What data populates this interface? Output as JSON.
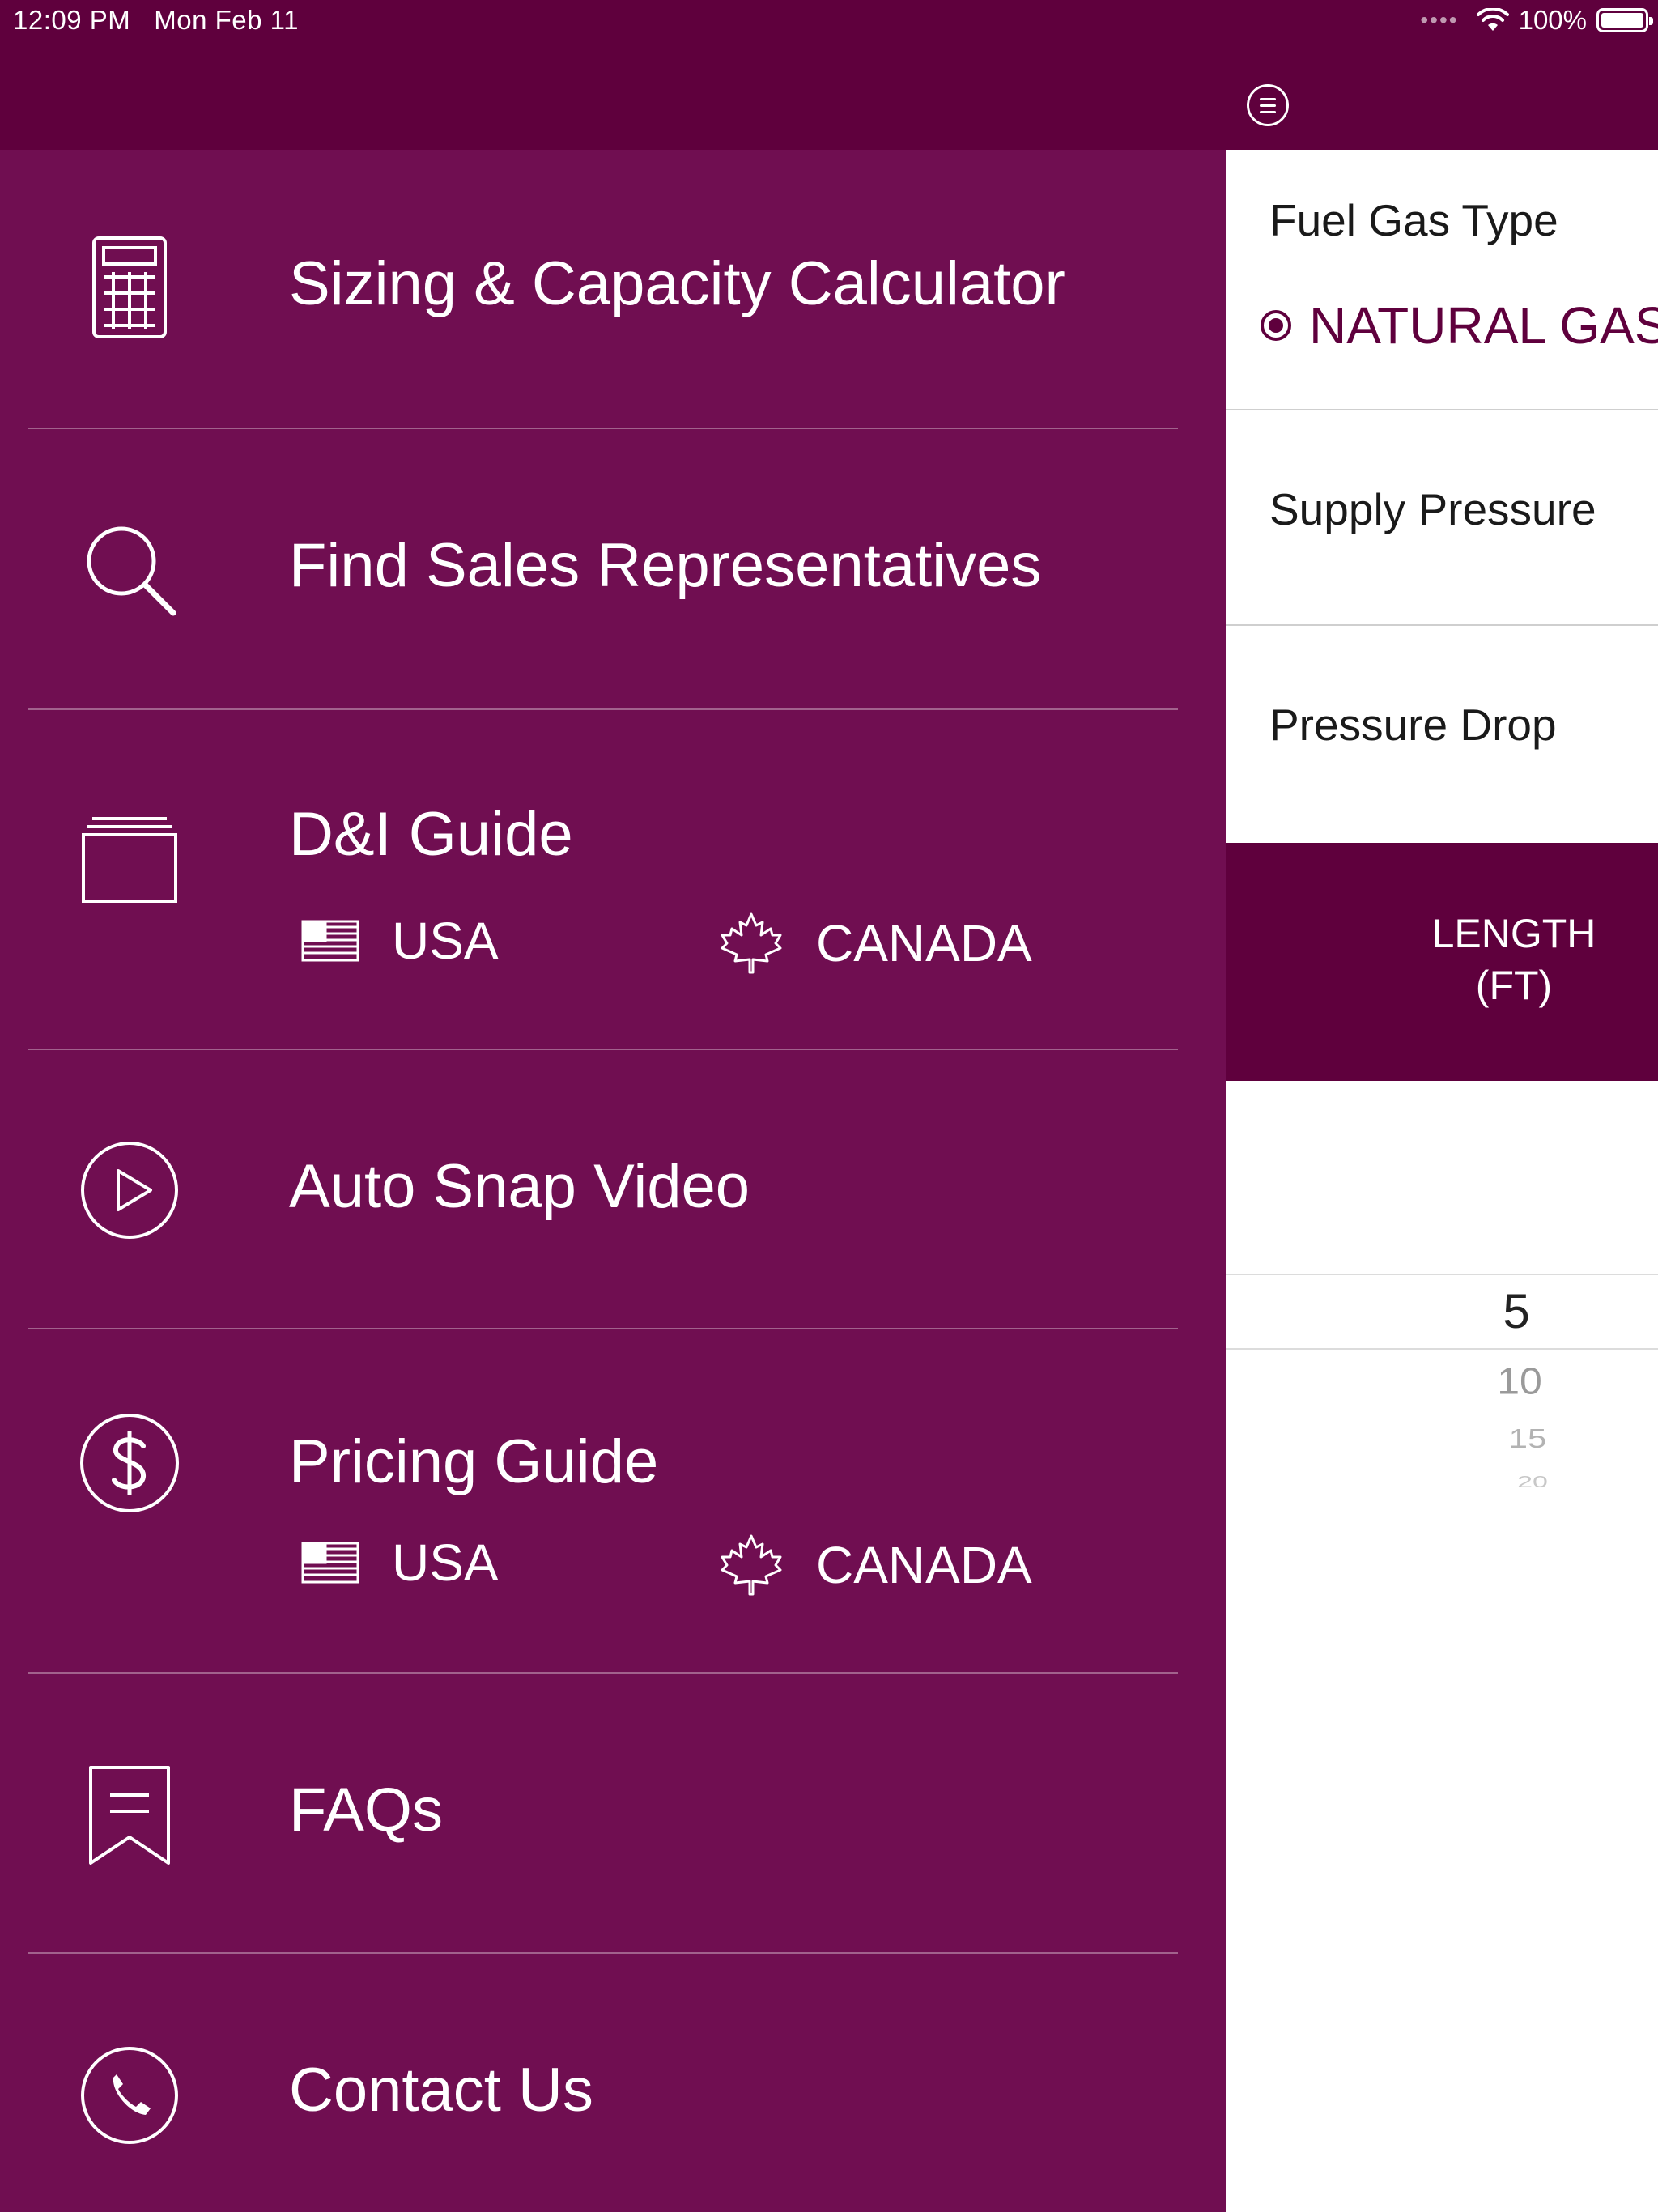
{
  "status_bar": {
    "time": "12:09 PM",
    "date": "Mon Feb 11",
    "battery": "100%"
  },
  "menu": {
    "items": [
      {
        "label": "Sizing & Capacity Calculator",
        "icon": "calculator-icon"
      },
      {
        "label": "Find Sales Representatives",
        "icon": "search-icon"
      },
      {
        "label": "D&I Guide",
        "icon": "folder-icon",
        "sub": [
          {
            "label": "USA",
            "icon": "usa-flag-icon"
          },
          {
            "label": "CANADA",
            "icon": "maple-leaf-icon"
          }
        ]
      },
      {
        "label": "Auto Snap Video",
        "icon": "play-icon"
      },
      {
        "label": "Pricing Guide",
        "icon": "dollar-icon",
        "sub": [
          {
            "label": "USA",
            "icon": "usa-flag-icon"
          },
          {
            "label": "CANADA",
            "icon": "maple-leaf-icon"
          }
        ]
      },
      {
        "label": "FAQs",
        "icon": "bookmark-icon"
      },
      {
        "label": "Contact Us",
        "icon": "phone-icon"
      }
    ]
  },
  "form": {
    "fuel_gas_type": {
      "label": "Fuel Gas Type",
      "selected": "NATURAL GAS"
    },
    "supply_pressure": {
      "label": "Supply Pressure"
    },
    "pressure_drop": {
      "label": "Pressure Drop"
    }
  },
  "length_column": {
    "header": "LENGTH\n(FT)",
    "picker_values": [
      "5",
      "10",
      "15",
      "20"
    ]
  },
  "colors": {
    "header_bg": "#5f003d",
    "menu_bg": "#700e51",
    "accent": "#5f003d"
  }
}
